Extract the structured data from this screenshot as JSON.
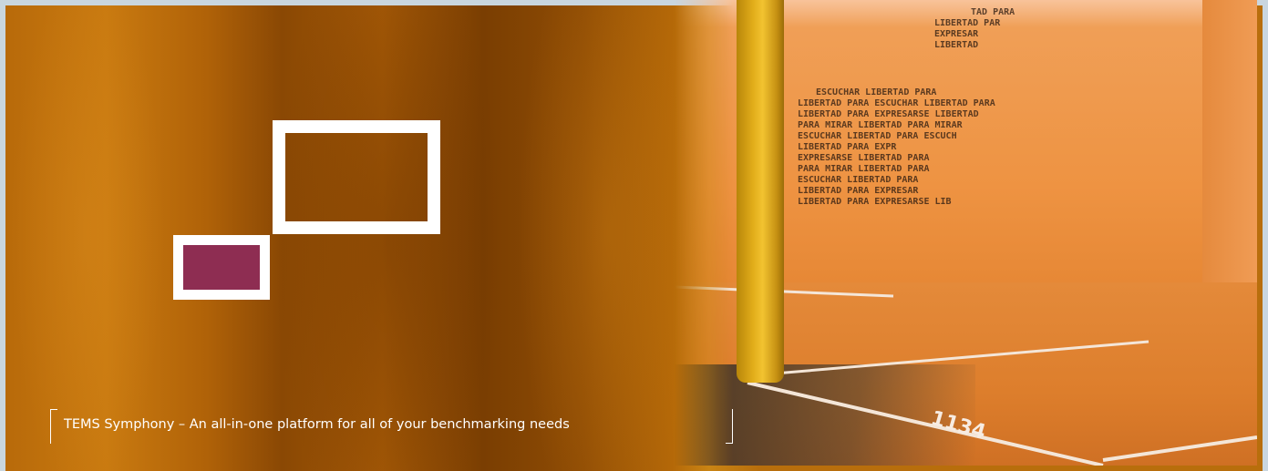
{
  "banner": {
    "caption": "TEMS Symphony – An all-in-one platform for all of your benchmarking needs",
    "colors": {
      "orange": "#b86a0a",
      "frame": "#ffffff",
      "accent_block": "#8e2d52",
      "wall": "#ee9342",
      "pillar": "#e2ad1a"
    }
  },
  "wall_text": {
    "lines": [
      "TAD PARA",
      "LIBERTAD PAR",
      "EXPRESAR",
      "LIBERTAD",
      "ESCUCHAR LIBERTAD PARA",
      "LIBERTAD PARA ESCUCHAR LIBERTAD PARA",
      "LIBERTAD PARA EXPRESARSE LIBERTAD",
      "PARA MIRAR LIBERTAD PARA MIRAR",
      "ESCUCHAR LIBERTAD PARA ESCUCH",
      "LIBERTAD PARA EXPR",
      "EXPRESARSE LIBERTAD PARA",
      "PARA MIRAR LIBERTAD PARA",
      "ESCUCHAR LIBERTAD PARA",
      "LIBERTAD PARA EXPRESAR",
      "LIBERTAD PARA EXPRESARSE LIB"
    ]
  },
  "floor_marking": "1134"
}
